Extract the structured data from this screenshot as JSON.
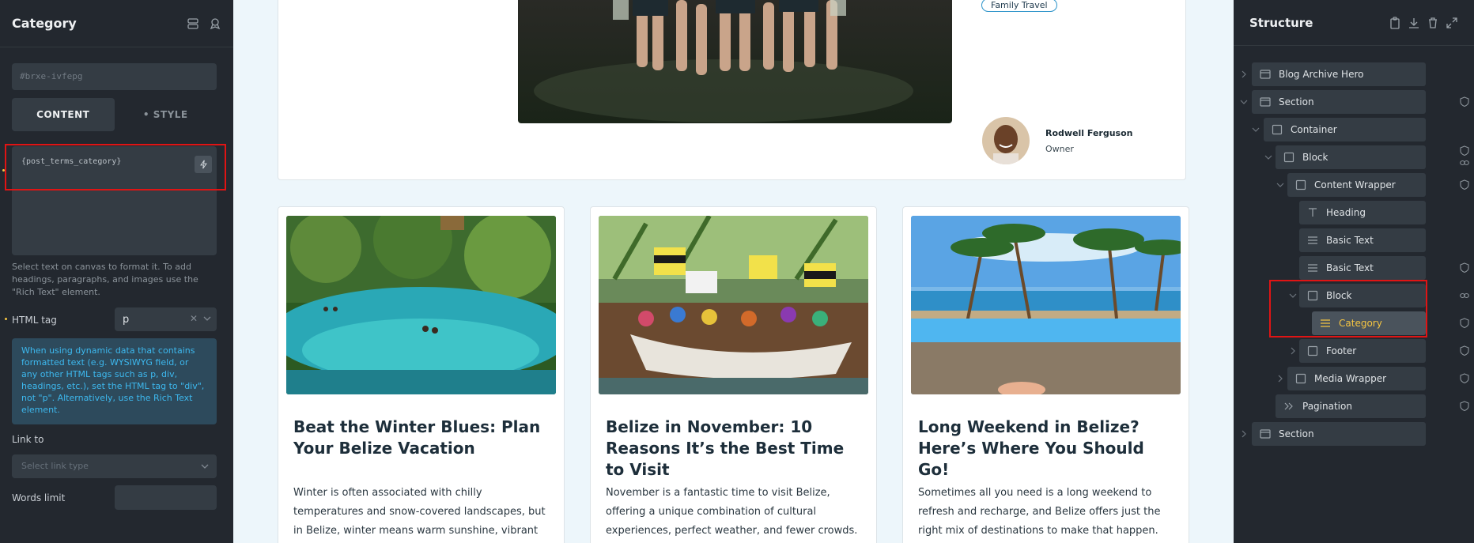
{
  "left_panel": {
    "title": "Category",
    "css_id": "#brxe-ivfepg",
    "tabs": {
      "content": "CONTENT",
      "style": "• STYLE"
    },
    "text_value": "{post_terms_category}",
    "helper_text": "Select text on canvas to format it. To add headings, paragraphs, and images use the \"Rich Text\" element.",
    "html_tag_label": "HTML tag",
    "html_tag_value": "p",
    "info_text": "When using dynamic data that contains formatted text (e.g. WYSIWYG field, or any other HTML tags such as p, div, headings, etc.), set the HTML tag to \"div\", not \"p\". Alternatively, use the Rich Text element.",
    "link_label": "Link to",
    "link_placeholder": "Select link type",
    "words_label": "Words limit"
  },
  "canvas": {
    "featured": {
      "tag": "Family Travel",
      "author_name": "Rodwell Ferguson",
      "author_role": "Owner"
    },
    "cards": [
      {
        "title": "Beat the Winter Blues: Plan Your Belize Vacation",
        "body": "Winter is often associated with chilly temperatures and snow-covered landscapes, but in Belize, winter means warm sunshine, vibrant culture, and endless opportunities for"
      },
      {
        "title": "Belize in November: 10 Reasons It’s the Best Time to Visit",
        "body": "November is a fantastic time to visit Belize, offering a unique combination of cultural experiences, perfect weather, and fewer crowds. Whether you’re looking to explore the"
      },
      {
        "title": "Long Weekend in Belize? Here’s Where You Should Go!",
        "body": "Sometimes all you need is a long weekend to refresh and recharge, and Belize offers just the right mix of destinations to make that happen. Whether you’re seeking adventure"
      }
    ]
  },
  "structure": {
    "title": "Structure",
    "items": [
      {
        "label": "Blog Archive Hero"
      },
      {
        "label": "Section"
      },
      {
        "label": "Container"
      },
      {
        "label": "Block"
      },
      {
        "label": "Content Wrapper"
      },
      {
        "label": "Heading"
      },
      {
        "label": "Basic Text"
      },
      {
        "label": "Basic Text"
      },
      {
        "label": "Block"
      },
      {
        "label": "Category"
      },
      {
        "label": "Footer"
      },
      {
        "label": "Media Wrapper"
      },
      {
        "label": "Pagination"
      },
      {
        "label": "Section"
      }
    ]
  },
  "colors": {
    "accent": "#f5c542",
    "highlight": "#e01414",
    "info": "#3db8ee"
  }
}
